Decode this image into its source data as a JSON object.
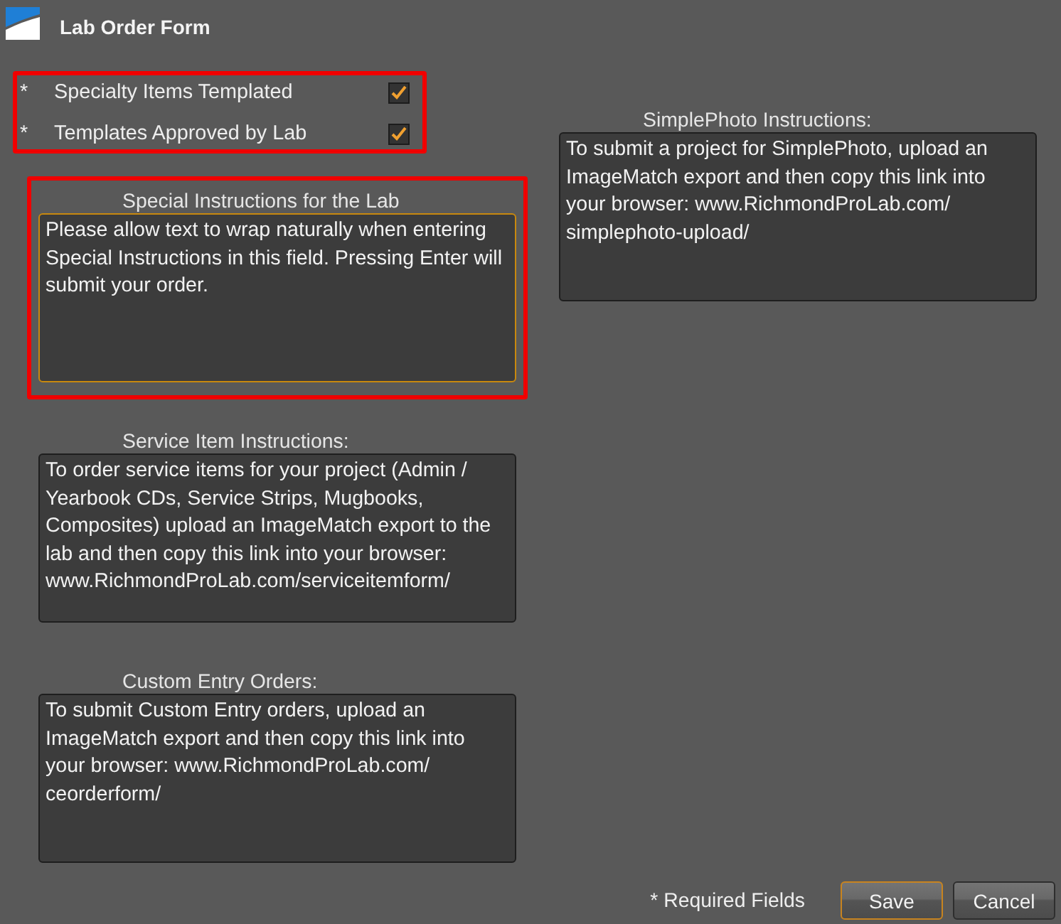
{
  "window": {
    "title": "Lab Order Form"
  },
  "required_checks": {
    "highlighted": true,
    "items": [
      {
        "marker": "*",
        "label": "Specialty Items Templated",
        "checked": true
      },
      {
        "marker": "*",
        "label": "Templates Approved by Lab",
        "checked": true
      }
    ]
  },
  "simplephoto_instructions": {
    "kind": "info",
    "highlighted": false,
    "label": "SimplePhoto Instructions:",
    "text": "To submit a project for SimplePhoto, upload an ImageMatch export and then copy this link into your browser: www.RichmondProLab.com/simplephoto-upload/"
  },
  "special_instructions": {
    "kind": "input",
    "highlighted": true,
    "focused": true,
    "label": "Special Instructions for the Lab",
    "text": "Please allow text to wrap naturally when entering Special Instructions in this field. Pressing Enter will submit your order."
  },
  "service_item_instructions": {
    "kind": "info",
    "highlighted": false,
    "label": "Service Item Instructions:",
    "text": "To order service items for your project (Admin / Yearbook CDs, Service Strips, Mugbooks, Composites) upload an ImageMatch export to the lab and then copy this link into your browser: www.RichmondProLab.com/serviceitemform/"
  },
  "custom_entry_orders": {
    "kind": "info",
    "highlighted": false,
    "label": "Custom Entry Orders:",
    "text": "To submit Custom Entry orders, upload an ImageMatch export and then copy this link into your browser: www.RichmondProLab.com/ceorderform/"
  },
  "footer": {
    "note": "* Required Fields",
    "buttons": [
      {
        "label": "Save",
        "default": true
      },
      {
        "label": "Cancel",
        "default": false
      }
    ]
  }
}
